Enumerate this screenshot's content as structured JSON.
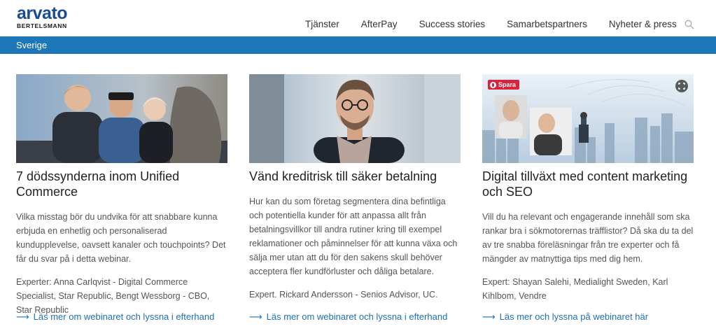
{
  "brand": {
    "name": "arvato",
    "sub": "BERTELSMANN"
  },
  "nav": [
    "Tjänster",
    "AfterPay",
    "Success stories",
    "Samarbetspartners",
    "Nyheter & press"
  ],
  "country": "Sverige",
  "cards": [
    {
      "title": "7 dödssynderna inom Unified Commerce",
      "text": "Vilka misstag bör du undvika för att snabbare kunna erbjuda en enhetlig och personaliserad kundupplevelse, oavsett kanaler och touchpoints? Det får du svar på i detta webinar.",
      "experts": "Experter: Anna Carlqvist - Digital Commerce Specialist, Star Republic, Bengt Wessborg - CBO, Star Republic",
      "link": "Läs mer om webinaret och lyssna i efterhand"
    },
    {
      "title": "Vänd kreditrisk till säker betalning",
      "text": "Hur kan du som företag segmentera dina befintliga och potentiella kunder för att anpassa allt från betalningsvillkor till andra rutiner kring till exempel reklamationer och påminnelser för att kunna växa och sälja mer utan att du för den sakens skull behöver acceptera fler kundförluster och dåliga betalare.",
      "experts": "Expert. Rickard Andersson - Senios Advisor, UC.",
      "link": "Läs mer om webinaret och lyssna i efterhand"
    },
    {
      "title": "Digital tillväxt med content marketing och SEO",
      "text": "Vill du ha relevant och engagerande innehåll som ska rankar bra i sökmotorernas träfflistor? Då ska du ta del av tre snabba föreläsningar från tre experter och få mängder av matnyttiga tips med dig hem.",
      "experts": "Expert: Shayan Salehi, Medialight Sweden, Karl Kihlbom, Vendre",
      "link": "Läs mer och lyssna på webinaret här",
      "pin_label": "Spara"
    }
  ],
  "colors": {
    "brand": "#1a4c8f",
    "bar": "#1e77b8",
    "link": "#1e6fb5"
  }
}
